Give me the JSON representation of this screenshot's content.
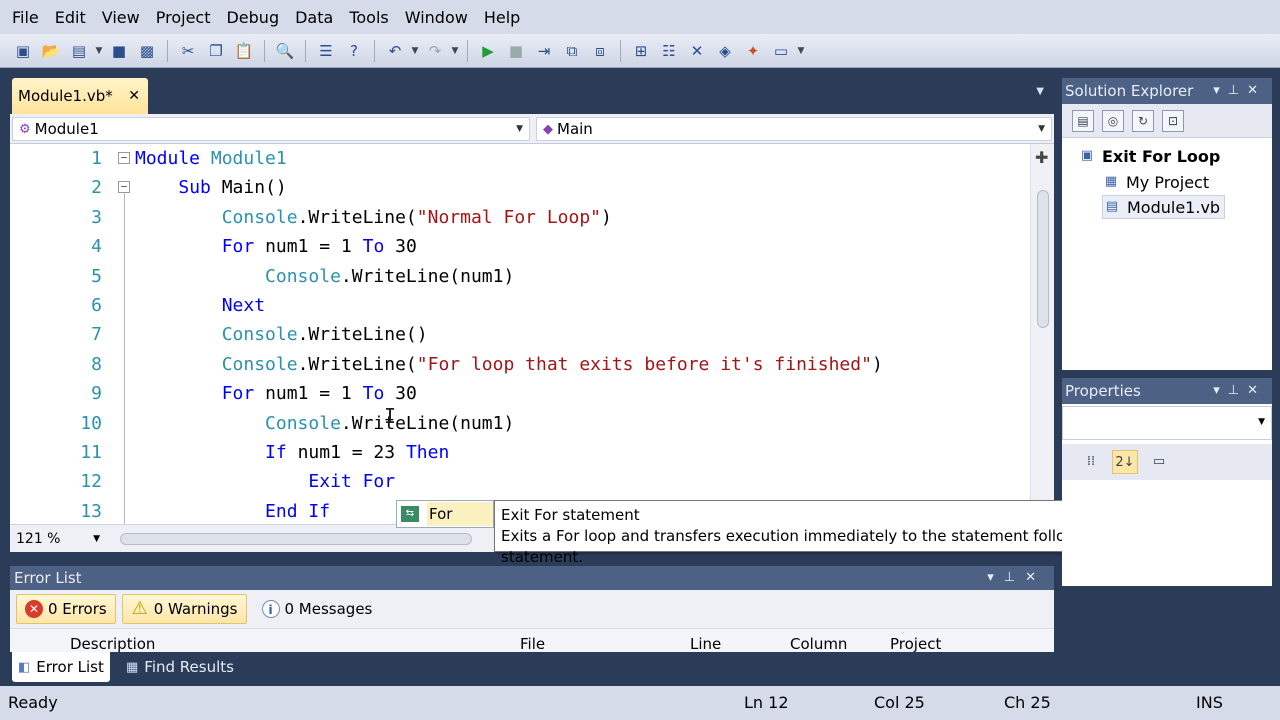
{
  "menu": [
    "File",
    "Edit",
    "View",
    "Project",
    "Debug",
    "Data",
    "Tools",
    "Window",
    "Help"
  ],
  "toolbar": {
    "buttons": [
      "new-project-icon",
      "open-file-icon",
      "add-item-icon",
      "save-icon",
      "save-all-icon",
      "cut-icon",
      "copy-icon",
      "paste-icon",
      "find-icon",
      "comment-icon",
      "uncomment-icon",
      "undo-icon",
      "redo-icon",
      "start-debug-icon",
      "stop-icon",
      "step-icon",
      "breakpoint-icon",
      "bookmark-icon",
      "solution-explorer-icon",
      "properties-icon",
      "toolbox-icon",
      "object-browser-icon",
      "extension-icon"
    ]
  },
  "document_tab": {
    "label": "Module1.vb*",
    "close": "✕"
  },
  "editor": {
    "nav_left": "Module1",
    "nav_right": "Main",
    "zoom": "121 %",
    "lines": [
      {
        "n": "1",
        "tokens": [
          {
            "c": "kw",
            "t": "Module "
          },
          {
            "c": "cls",
            "t": "Module1"
          }
        ]
      },
      {
        "n": "2",
        "tokens": [
          {
            "c": "txt",
            "t": "    "
          },
          {
            "c": "kw",
            "t": "Sub "
          },
          {
            "c": "txt",
            "t": "Main()"
          }
        ]
      },
      {
        "n": "3",
        "tokens": [
          {
            "c": "txt",
            "t": "        "
          },
          {
            "c": "cls",
            "t": "Console"
          },
          {
            "c": "txt",
            "t": ".WriteLine("
          },
          {
            "c": "str",
            "t": "\"Normal For Loop\""
          },
          {
            "c": "txt",
            "t": ")"
          }
        ]
      },
      {
        "n": "4",
        "tokens": [
          {
            "c": "txt",
            "t": "        "
          },
          {
            "c": "kw",
            "t": "For "
          },
          {
            "c": "txt",
            "t": "num1 = 1 "
          },
          {
            "c": "kw",
            "t": "To "
          },
          {
            "c": "txt",
            "t": "30"
          }
        ]
      },
      {
        "n": "5",
        "tokens": [
          {
            "c": "txt",
            "t": "            "
          },
          {
            "c": "cls",
            "t": "Console"
          },
          {
            "c": "txt",
            "t": ".WriteLine(num1)"
          }
        ]
      },
      {
        "n": "6",
        "tokens": [
          {
            "c": "txt",
            "t": "        "
          },
          {
            "c": "kw",
            "t": "Next"
          }
        ]
      },
      {
        "n": "7",
        "tokens": [
          {
            "c": "txt",
            "t": "        "
          },
          {
            "c": "cls",
            "t": "Console"
          },
          {
            "c": "txt",
            "t": ".WriteLine()"
          }
        ]
      },
      {
        "n": "8",
        "tokens": [
          {
            "c": "txt",
            "t": "        "
          },
          {
            "c": "cls",
            "t": "Console"
          },
          {
            "c": "txt",
            "t": ".WriteLine("
          },
          {
            "c": "str",
            "t": "\"For loop that exits before it's finished\""
          },
          {
            "c": "txt",
            "t": ")"
          }
        ]
      },
      {
        "n": "9",
        "tokens": [
          {
            "c": "txt",
            "t": "        "
          },
          {
            "c": "kw",
            "t": "For "
          },
          {
            "c": "txt",
            "t": "num1 = 1 "
          },
          {
            "c": "kw",
            "t": "To "
          },
          {
            "c": "txt",
            "t": "30"
          }
        ]
      },
      {
        "n": "10",
        "tokens": [
          {
            "c": "txt",
            "t": "            "
          },
          {
            "c": "cls",
            "t": "Console"
          },
          {
            "c": "txt",
            "t": ".WriteLine(num1)"
          }
        ]
      },
      {
        "n": "11",
        "tokens": [
          {
            "c": "txt",
            "t": "            "
          },
          {
            "c": "kw",
            "t": "If "
          },
          {
            "c": "txt",
            "t": "num1 = 23 "
          },
          {
            "c": "kw",
            "t": "Then"
          }
        ]
      },
      {
        "n": "12",
        "tokens": [
          {
            "c": "txt",
            "t": "                "
          },
          {
            "c": "kw",
            "t": "Exit For"
          }
        ]
      },
      {
        "n": "13",
        "tokens": [
          {
            "c": "txt",
            "t": "            "
          },
          {
            "c": "kw",
            "t": "End If"
          }
        ]
      }
    ]
  },
  "intellisense": {
    "item": "For",
    "tooltip_title": "Exit For statement",
    "tooltip_body": "Exits a For loop and transfers execution immediately to the statement following the Next statement."
  },
  "error_list": {
    "title": "Error List",
    "errors": "0 Errors",
    "warnings": "0 Warnings",
    "messages": "0 Messages",
    "columns": [
      "Description",
      "File",
      "Line",
      "Column",
      "Project"
    ]
  },
  "bottom_tabs": [
    "Error List",
    "Find Results"
  ],
  "solution_explorer": {
    "title": "Solution Explorer",
    "tree": [
      "Exit For Loop",
      "My Project",
      "Module1.vb"
    ]
  },
  "properties": {
    "title": "Properties"
  },
  "status": {
    "ready": "Ready",
    "ln": "Ln 12",
    "col": "Col 25",
    "ch": "Ch 25",
    "ins": "INS"
  },
  "colors": {
    "keyword": "#0000ff",
    "type": "#2b91af",
    "string": "#a31515",
    "chrome": "#2b3c59"
  }
}
